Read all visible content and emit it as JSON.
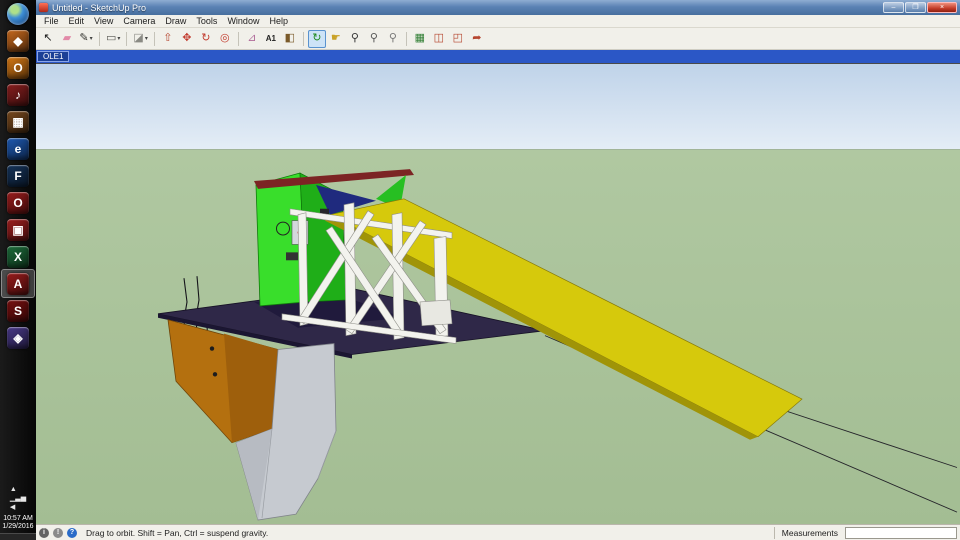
{
  "window": {
    "title": "Untitled - SketchUp Pro",
    "caption_buttons": [
      {
        "name": "minimize-button",
        "glyph": "–"
      },
      {
        "name": "maximize-button",
        "glyph": "❐"
      },
      {
        "name": "close-button",
        "glyph": "×",
        "close": true
      }
    ]
  },
  "menu": {
    "items": [
      "File",
      "Edit",
      "View",
      "Camera",
      "Draw",
      "Tools",
      "Window",
      "Help"
    ]
  },
  "toolbar": {
    "tools": [
      {
        "name": "select-tool",
        "glyph": "↖",
        "color": "#1a1a1a"
      },
      {
        "name": "eraser-tool",
        "glyph": "▰",
        "color": "#e28aa8"
      },
      {
        "name": "line-tool",
        "glyph": "✎",
        "color": "#33332f",
        "dropdown": true
      },
      {
        "name": "shapes-tool",
        "glyph": "▭",
        "color": "#555550",
        "dropdown": true,
        "sep": true
      },
      {
        "name": "sandbox-tool",
        "glyph": "◪",
        "color": "#8a8a84",
        "dropdown": true,
        "sep": true
      },
      {
        "name": "pushpull-tool",
        "glyph": "⇧",
        "color": "#b5452f",
        "sep": true
      },
      {
        "name": "move-tool",
        "glyph": "✥",
        "color": "#c23b2e"
      },
      {
        "name": "rotate-tool",
        "glyph": "↻",
        "color": "#c23b2e"
      },
      {
        "name": "offset-tool",
        "glyph": "◎",
        "color": "#c23b2e"
      },
      {
        "name": "tape-measure-tool",
        "glyph": "⊿",
        "color": "#b06a9a",
        "sep": true
      },
      {
        "name": "text-tool",
        "glyph": "A1",
        "color": "#222222"
      },
      {
        "name": "paint-bucket-tool",
        "glyph": "◧",
        "color": "#7a5a2a"
      },
      {
        "name": "orbit-tool",
        "glyph": "↻",
        "color": "#1f8a1f",
        "active": true,
        "sep": true
      },
      {
        "name": "pan-tool",
        "glyph": "☛",
        "color": "#c9a227"
      },
      {
        "name": "zoom-tool",
        "glyph": "⚲",
        "color": "#333333"
      },
      {
        "name": "zoom-window-tool",
        "glyph": "⚲",
        "color": "#555555"
      },
      {
        "name": "zoom-extents-tool",
        "glyph": "⚲",
        "color": "#777777"
      },
      {
        "name": "views-tool",
        "glyph": "▦",
        "color": "#2e7d32",
        "sep": true
      },
      {
        "name": "shadows-tool",
        "glyph": "◫",
        "color": "#b5452f"
      },
      {
        "name": "section-plane-tool",
        "glyph": "◰",
        "color": "#b5452f"
      },
      {
        "name": "send-to-layout-tool",
        "glyph": "➦",
        "color": "#b5452f"
      }
    ]
  },
  "ole": {
    "label": "OLE1"
  },
  "statusbar": {
    "icons": [
      {
        "name": "model-info-icon",
        "glyph": "i",
        "bg": "#636363"
      },
      {
        "name": "credits-icon",
        "glyph": "!",
        "bg": "#8a8a8a"
      },
      {
        "name": "geolocation-icon",
        "glyph": "?",
        "bg": "#2a6bc8"
      }
    ],
    "hint": "Drag to orbit. Shift = Pan, Ctrl = suspend gravity.",
    "measurements_label": "Measurements",
    "measurements_value": ""
  },
  "taskbar": {
    "time": "10:57 AM",
    "date": "1/29/2016",
    "apps": [
      {
        "name": "app-icon-1",
        "bg": "#c96a1e",
        "glyph": "◆"
      },
      {
        "name": "app-icon-2",
        "bg": "#d97b16",
        "glyph": "O"
      },
      {
        "name": "app-icon-3",
        "bg": "#8a1f1f",
        "glyph": "♪"
      },
      {
        "name": "app-icon-4",
        "bg": "#7a4a1e",
        "glyph": "▦"
      },
      {
        "name": "internet-explorer-icon",
        "bg": "#1f5bb5",
        "glyph": "e"
      },
      {
        "name": "firefox-icon",
        "bg": "#16345a",
        "glyph": "F"
      },
      {
        "name": "opera-icon",
        "bg": "#9c1d1d",
        "glyph": "O"
      },
      {
        "name": "adobe-icon",
        "bg": "#a02020",
        "glyph": "▣"
      },
      {
        "name": "excel-icon",
        "bg": "#1e6e3c",
        "glyph": "X"
      },
      {
        "name": "adobe-reader-icon",
        "bg": "#9b1c1c",
        "glyph": "A",
        "active": true
      },
      {
        "name": "flash-icon",
        "bg": "#7a1010",
        "glyph": "S"
      },
      {
        "name": "app-icon-12",
        "bg": "#4a3a8a",
        "glyph": "◈"
      }
    ],
    "tray": [
      {
        "name": "hidden-icons-button",
        "glyph": "▲"
      },
      {
        "name": "network-icon",
        "glyph": "▁▃▅"
      },
      {
        "name": "volume-icon",
        "glyph": "◀"
      }
    ]
  },
  "colors": {
    "titlebar_blue": "#5b82b4",
    "ole_band_blue": "#2b57c6",
    "sky": "#c9daec",
    "ground": "#a7c29a",
    "model_green": "#39de2b",
    "model_yellow": "#d6c90c",
    "deck_navy": "#2f2848",
    "hull_orange": "#b4700f",
    "hull_gray": "#c6cad0"
  }
}
